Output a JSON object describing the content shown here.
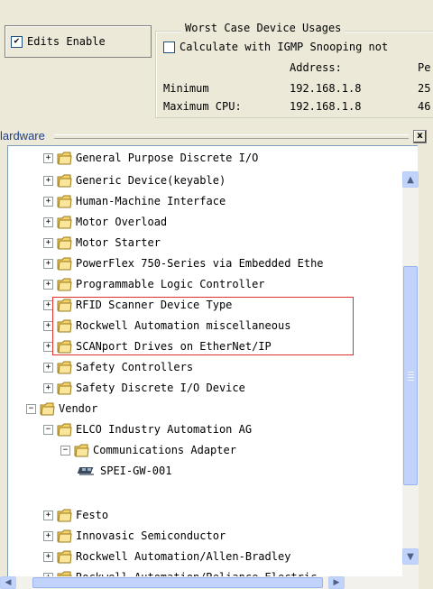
{
  "top": {
    "edits_enable": {
      "label": "Edits Enable",
      "checked": true,
      "check_glyph": "✔"
    },
    "worst_case": {
      "title": "Worst Case Device Usages",
      "igmp_label": "Calculate with IGMP Snooping not",
      "col_address": "Address:",
      "col_pe": "Pe",
      "rows": [
        {
          "label": "Minimum",
          "address": "192.168.1.8",
          "value": "25"
        },
        {
          "label": "Maximum CPU:",
          "address": "192.168.1.8",
          "value": "46"
        }
      ]
    }
  },
  "hardware": {
    "title": "lardware",
    "close_glyph": "x"
  },
  "tree": {
    "expand_glyph": "+",
    "collapse_glyph": "−",
    "items": [
      {
        "label": "General Purpose Discrete I/O",
        "kind": "folder",
        "state": "collapsed"
      },
      {
        "label": "Generic Device(keyable)",
        "kind": "folder",
        "state": "collapsed"
      },
      {
        "label": "Human-Machine Interface",
        "kind": "folder",
        "state": "collapsed"
      },
      {
        "label": "Motor Overload",
        "kind": "folder",
        "state": "collapsed"
      },
      {
        "label": "Motor Starter",
        "kind": "folder",
        "state": "collapsed"
      },
      {
        "label": "PowerFlex 750-Series via Embedded Ethe",
        "kind": "folder",
        "state": "collapsed"
      },
      {
        "label": "Programmable Logic Controller",
        "kind": "folder",
        "state": "collapsed"
      },
      {
        "label": "RFID Scanner Device Type",
        "kind": "folder",
        "state": "collapsed"
      },
      {
        "label": "Rockwell Automation miscellaneous",
        "kind": "folder",
        "state": "collapsed"
      },
      {
        "label": "SCANport Drives on EtherNet/IP",
        "kind": "folder",
        "state": "collapsed"
      },
      {
        "label": "Safety Controllers",
        "kind": "folder",
        "state": "collapsed"
      },
      {
        "label": "Safety Discrete I/O Device",
        "kind": "folder",
        "state": "collapsed"
      },
      {
        "label": "Vendor",
        "kind": "folder",
        "state": "expanded"
      },
      {
        "label": "ELCO Industry Automation AG",
        "kind": "folder",
        "state": "expanded"
      },
      {
        "label": "Communications Adapter",
        "kind": "folder",
        "state": "expanded"
      },
      {
        "label": "SPEI-GW-001",
        "kind": "device",
        "state": "leaf"
      },
      {
        "label": "Festo",
        "kind": "folder",
        "state": "collapsed"
      },
      {
        "label": "Innovasic Semiconductor",
        "kind": "folder",
        "state": "collapsed"
      },
      {
        "label": "Rockwell Automation/Allen-Bradley",
        "kind": "folder",
        "state": "collapsed"
      },
      {
        "label": "Rockwell Automation/Reliance Electric",
        "kind": "folder",
        "state": "collapsed"
      }
    ]
  },
  "scrollbars": {
    "up_glyph": "▲",
    "down_glyph": "▼",
    "left_glyph": "◀",
    "right_glyph": "▶"
  },
  "colors": {
    "highlight_border": "#e0312e",
    "folder_fill": "#f5d36a",
    "folder_edge": "#9a7b1c"
  }
}
